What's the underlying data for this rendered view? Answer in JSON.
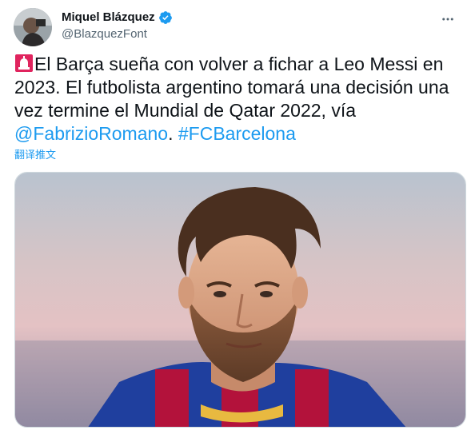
{
  "author": {
    "display_name": "Miquel Blázquez",
    "handle": "@BlazquezFont",
    "verified": true,
    "avatar": "user-avatar"
  },
  "tweet": {
    "emoji": "rotating-light-emoji",
    "text_part1": "El Barça sueña con volver a fichar a Leo Messi en 2023. El futbolista argentino tomará una decisión una vez termine el Mundial de Qatar 2022, vía ",
    "mention": "@FabrizioRomano",
    "separator": ". ",
    "hashtag": "#FCBarcelona",
    "translate_label": "翻译推文"
  },
  "icons": {
    "more": "more-horizontal-icon",
    "verified": "verified-badge-icon"
  },
  "colors": {
    "accent": "#1d9bf0",
    "text": "#0f1419",
    "secondary": "#536471",
    "shirt_blue": "#1f3f9e",
    "shirt_red": "#b3123b"
  }
}
